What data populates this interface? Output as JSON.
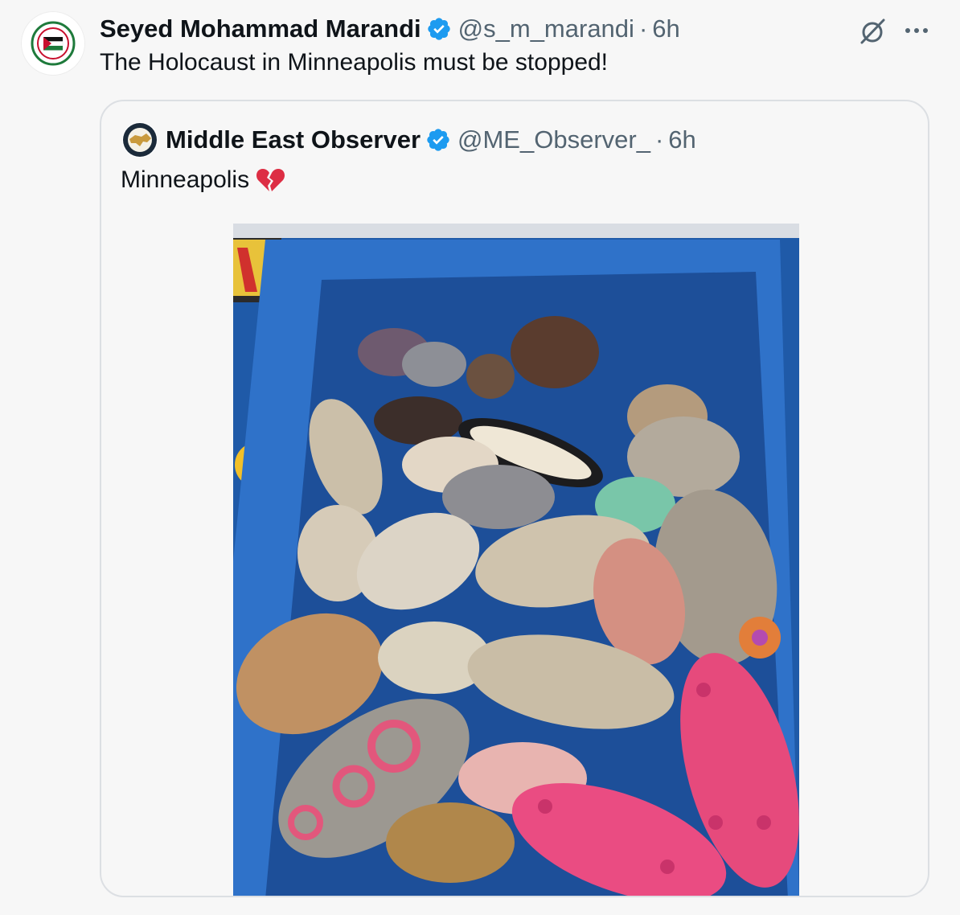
{
  "tweet": {
    "author_name": "Seyed Mohammad Marandi",
    "handle": "@s_m_marandi",
    "separator": "·",
    "time": "6h",
    "text": "The Holocaust in Minneapolis must be stopped!",
    "avatar_icon": "save-gaza-palestine-flag-logo",
    "actions": {
      "grok_icon": "grok-icon",
      "more_icon": "more-icon"
    }
  },
  "quoted_tweet": {
    "author_name": "Middle East Observer",
    "handle": "@ME_Observer_",
    "separator": "·",
    "time": "6h",
    "text": "Minneapolis",
    "emoji": "broken-heart-icon",
    "image": {
      "description_icon": "photo-of-childrens-shoes-in-blue-bin",
      "background_color": "#2a66b8"
    }
  },
  "colors": {
    "verified": "#1d9bf0",
    "secondary_text": "#536471",
    "border": "#dcdfe3",
    "background": "#f7f7f7"
  }
}
